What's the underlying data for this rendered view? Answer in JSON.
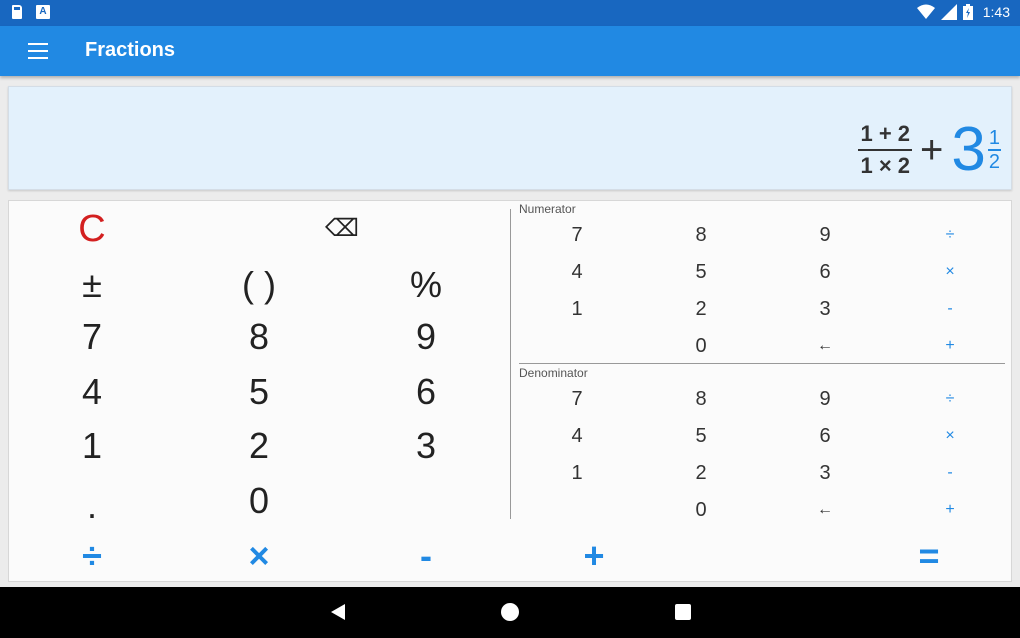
{
  "status_bar": {
    "time": "1:43",
    "icons": [
      "sd-card-icon",
      "keyboard-a-icon",
      "wifi-icon",
      "signal-icon",
      "battery-charging-icon"
    ]
  },
  "app_bar": {
    "title": "Fractions"
  },
  "display": {
    "fraction": {
      "numerator": "1 + 2",
      "denominator": "1 × 2"
    },
    "operator": "+",
    "mixed": {
      "whole": "3",
      "numerator": "1",
      "denominator": "2"
    }
  },
  "keypad": {
    "clear": "C",
    "backspace": "⌫",
    "rows": [
      [
        "±",
        "( )",
        "%"
      ],
      [
        "7",
        "8",
        "9"
      ],
      [
        "4",
        "5",
        "6"
      ],
      [
        "1",
        "2",
        "3"
      ],
      [
        ".",
        "0",
        ""
      ]
    ],
    "numerator": {
      "label": "Numerator",
      "rows": [
        [
          "7",
          "8",
          "9",
          "÷"
        ],
        [
          "4",
          "5",
          "6",
          "×"
        ],
        [
          "1",
          "2",
          "3",
          "-"
        ],
        [
          "",
          "0",
          "←",
          "+"
        ]
      ]
    },
    "denominator": {
      "label": "Denominator",
      "rows": [
        [
          "7",
          "8",
          "9",
          "÷"
        ],
        [
          "4",
          "5",
          "6",
          "×"
        ],
        [
          "1",
          "2",
          "3",
          "-"
        ],
        [
          "",
          "0",
          "←",
          "+"
        ]
      ]
    },
    "operators": [
      "÷",
      "×",
      "-",
      "+",
      "="
    ]
  },
  "colors": {
    "primary": "#2189e3",
    "status_bar": "#1867c0",
    "clear": "#d32020",
    "display_bg": "#e3f1fc"
  }
}
